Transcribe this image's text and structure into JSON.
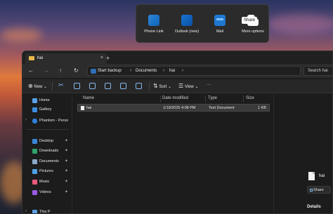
{
  "share_flyout": {
    "items": [
      {
        "label": "Phone Link",
        "icon": "phone-link-icon"
      },
      {
        "label": "Outlook (new)",
        "icon": "outlook-icon"
      },
      {
        "label": "Mail",
        "icon": "mail-icon"
      },
      {
        "label": "More options",
        "icon": "more-options-icon"
      }
    ],
    "tooltip": "Share"
  },
  "window": {
    "tab_title": "hai",
    "new_tab": "+",
    "tab_close": "×",
    "breadcrumb": [
      "Start backup",
      "Documents",
      "hai"
    ],
    "search_placeholder": "Search hai"
  },
  "toolbar": {
    "new_label": "New",
    "sort_label": "Sort",
    "view_label": "View",
    "more_label": "···"
  },
  "sidebar": {
    "items": [
      {
        "label": "Home",
        "icon": "home-icon",
        "color": "#5aa0e6"
      },
      {
        "label": "Gallery",
        "icon": "gallery-icon",
        "color": "#3d8de0"
      },
      {
        "label": "Phantom - Perso",
        "icon": "cloud-icon",
        "color": "#2f7ed8"
      },
      {
        "label": "Desktop",
        "icon": "desktop-icon",
        "color": "#3a86d6"
      },
      {
        "label": "Downloads",
        "icon": "downloads-icon",
        "color": "#2fa36b"
      },
      {
        "label": "Documents",
        "icon": "documents-icon",
        "color": "#8aa9c8"
      },
      {
        "label": "Pictures",
        "icon": "pictures-icon",
        "color": "#4fa1e8"
      },
      {
        "label": "Music",
        "icon": "music-icon",
        "color": "#e85a7a"
      },
      {
        "label": "Videos",
        "icon": "videos-icon",
        "color": "#9a5ae0"
      },
      {
        "label": "This P",
        "icon": "this-pc-icon",
        "color": "#5aa0e6"
      }
    ]
  },
  "columns": [
    "Name",
    "Date modified",
    "Type",
    "Size"
  ],
  "files": [
    {
      "name": "hai",
      "date": "1/19/2025 4:08 PM",
      "type": "Text Document",
      "size": "1 KB"
    }
  ],
  "details": {
    "file_name": "hai",
    "share_label": "Share",
    "section_label": "Details"
  }
}
